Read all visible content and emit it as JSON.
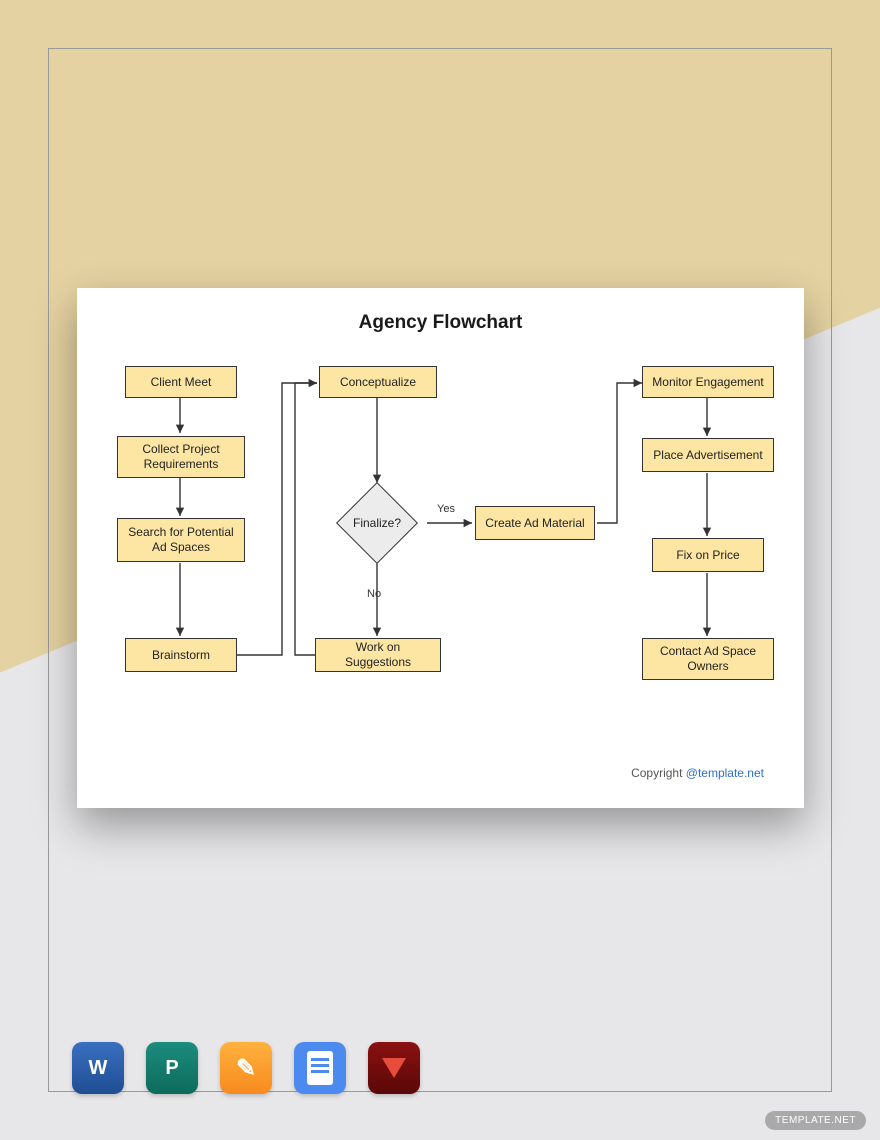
{
  "title": "Agency Flowchart",
  "nodes": {
    "client_meet": "Client Meet",
    "collect_req": "Collect Project Requirements",
    "search_spaces": "Search for Potential Ad Spaces",
    "brainstorm": "Brainstorm",
    "conceptualize": "Conceptualize",
    "finalize": "Finalize?",
    "work_suggestions": "Work on Suggestions",
    "create_material": "Create Ad Material",
    "monitor": "Monitor Engagement",
    "place_ad": "Place Advertisement",
    "fix_price": "Fix on Price",
    "contact_owners": "Contact Ad Space Owners"
  },
  "edge_labels": {
    "yes": "Yes",
    "no": "No"
  },
  "copyright": {
    "prefix": "Copyright ",
    "link_text": "@template.net"
  },
  "app_icons": [
    "word-icon",
    "publisher-icon",
    "pages-icon",
    "google-docs-icon",
    "pdf-icon"
  ],
  "watermark": "TEMPLATE.NET",
  "chart_data": {
    "type": "flowchart",
    "title": "Agency Flowchart",
    "nodes": [
      {
        "id": "client_meet",
        "label": "Client Meet",
        "shape": "process"
      },
      {
        "id": "collect_req",
        "label": "Collect Project Requirements",
        "shape": "process"
      },
      {
        "id": "search_spaces",
        "label": "Search for Potential Ad Spaces",
        "shape": "process"
      },
      {
        "id": "brainstorm",
        "label": "Brainstorm",
        "shape": "process"
      },
      {
        "id": "conceptualize",
        "label": "Conceptualize",
        "shape": "process"
      },
      {
        "id": "finalize",
        "label": "Finalize?",
        "shape": "decision"
      },
      {
        "id": "work_suggestions",
        "label": "Work on Suggestions",
        "shape": "process"
      },
      {
        "id": "create_material",
        "label": "Create Ad Material",
        "shape": "process"
      },
      {
        "id": "monitor",
        "label": "Monitor Engagement",
        "shape": "process"
      },
      {
        "id": "place_ad",
        "label": "Place Advertisement",
        "shape": "process"
      },
      {
        "id": "fix_price",
        "label": "Fix on Price",
        "shape": "process"
      },
      {
        "id": "contact_owners",
        "label": "Contact Ad Space Owners",
        "shape": "process"
      }
    ],
    "edges": [
      {
        "from": "client_meet",
        "to": "collect_req"
      },
      {
        "from": "collect_req",
        "to": "search_spaces"
      },
      {
        "from": "search_spaces",
        "to": "brainstorm"
      },
      {
        "from": "brainstorm",
        "to": "conceptualize"
      },
      {
        "from": "conceptualize",
        "to": "finalize"
      },
      {
        "from": "finalize",
        "to": "create_material",
        "label": "Yes"
      },
      {
        "from": "finalize",
        "to": "work_suggestions",
        "label": "No"
      },
      {
        "from": "work_suggestions",
        "to": "conceptualize"
      },
      {
        "from": "create_material",
        "to": "monitor"
      },
      {
        "from": "monitor",
        "to": "place_ad"
      },
      {
        "from": "place_ad",
        "to": "fix_price"
      },
      {
        "from": "fix_price",
        "to": "contact_owners"
      }
    ]
  }
}
